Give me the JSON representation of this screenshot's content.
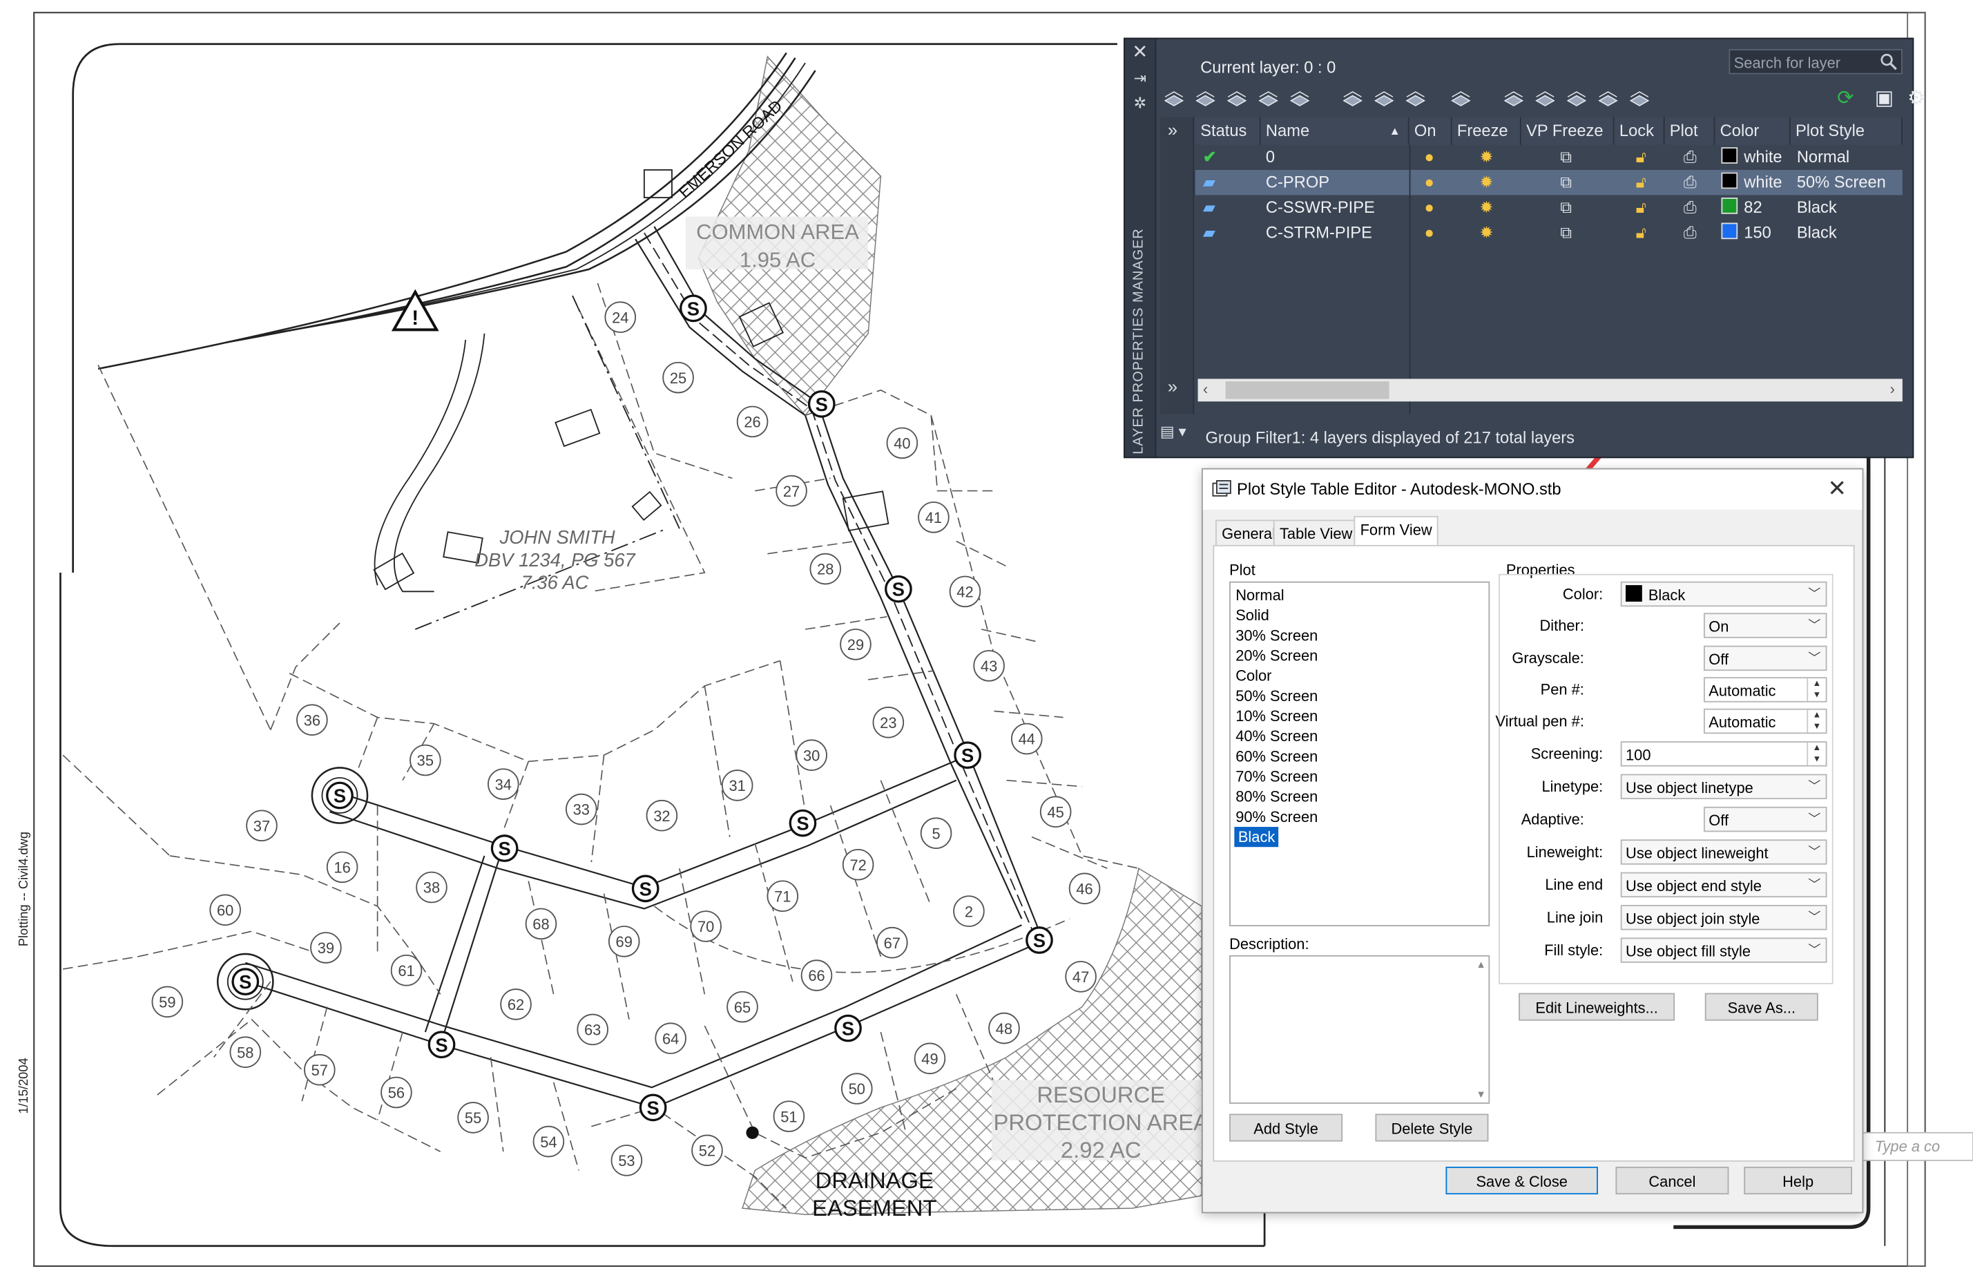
{
  "drawing": {
    "road_label": "EMERSON ROAD",
    "common_area": {
      "title": "COMMON AREA",
      "acres": "1.95 AC"
    },
    "owner": {
      "name": "JOHN SMITH",
      "deed": "DBV 1234, PG 567",
      "acres": "7.36 AC"
    },
    "resource_area": {
      "line1": "RESOURCE",
      "line2": "PROTECTION AREA",
      "acres": "2.92 AC"
    },
    "drainage": {
      "line1": "DRAINAGE",
      "line2": "EASEMENT"
    },
    "plot_info": {
      "plotting": "Plotting",
      "separator": "--",
      "file": "Civil4.dwg",
      "date": "1/15/2004"
    },
    "manhole_symbol": "S",
    "command_hint": "Type a co",
    "lots": [
      "24",
      "25",
      "26",
      "27",
      "28",
      "29",
      "23",
      "30",
      "31",
      "32",
      "33",
      "34",
      "35",
      "36",
      "37",
      "16",
      "38",
      "60",
      "39",
      "61",
      "59",
      "58",
      "57",
      "56",
      "55",
      "54",
      "53",
      "52",
      "51",
      "50",
      "49",
      "48",
      "47",
      "46",
      "45",
      "44",
      "43",
      "42",
      "41",
      "40",
      "5",
      "72",
      "71",
      "70",
      "69",
      "68",
      "62",
      "63",
      "64",
      "65",
      "66",
      "67",
      "2"
    ]
  },
  "layer_panel": {
    "title": "LAYER PROPERTIES MANAGER",
    "current_layer": "Current layer: 0 : 0",
    "search_placeholder": "Search for layer",
    "columns": [
      "Status",
      "Name",
      "On",
      "Freeze",
      "VP Freeze",
      "Lock",
      "Plot",
      "Color",
      "Plot Style"
    ],
    "rows": [
      {
        "name": "0",
        "color_name": "white",
        "color_hex": "#000000",
        "plot_style": "Normal",
        "status": "current",
        "selected": false
      },
      {
        "name": "C-PROP",
        "color_name": "white",
        "color_hex": "#000000",
        "plot_style": "50% Screen",
        "status": "layer",
        "selected": true
      },
      {
        "name": "C-SSWR-PIPE",
        "color_name": "82",
        "color_hex": "#1a9a2a",
        "plot_style": "Black",
        "status": "layer",
        "selected": false
      },
      {
        "name": "C-STRM-PIPE",
        "color_name": "150",
        "color_hex": "#1a6cf0",
        "plot_style": "Black",
        "status": "layer",
        "selected": false
      }
    ],
    "status_text": "Group Filter1: 4 layers displayed of 217 total layers"
  },
  "plot_style_editor": {
    "title": "Plot Style Table Editor - Autodesk-MONO.stb",
    "tabs": [
      "General",
      "Table View",
      "Form View"
    ],
    "active_tab": "Form View",
    "plot_label": "Plot",
    "plot_styles": [
      "Normal",
      "Solid",
      "30% Screen",
      "20% Screen",
      "Color",
      "50% Screen",
      "10% Screen",
      "40% Screen",
      "60% Screen",
      "70% Screen",
      "80% Screen",
      "90% Screen",
      "Black"
    ],
    "selected_style": "Black",
    "description_label": "Description:",
    "properties_label": "Properties",
    "properties": {
      "color_label": "Color:",
      "color_value": "Black",
      "dither_label": "Dither:",
      "dither_value": "On",
      "grayscale_label": "Grayscale:",
      "grayscale_value": "Off",
      "pen_label": "Pen #:",
      "pen_value": "Automatic",
      "virtual_pen_label": "Virtual pen #:",
      "virtual_pen_value": "Automatic",
      "screening_label": "Screening:",
      "screening_value": "100",
      "linetype_label": "Linetype:",
      "linetype_value": "Use object linetype",
      "adaptive_label": "Adaptive:",
      "adaptive_value": "Off",
      "lineweight_label": "Lineweight:",
      "lineweight_value": "Use object lineweight",
      "line_end_label": "Line end",
      "line_end_value": "Use object end style",
      "line_join_label": "Line join",
      "line_join_value": "Use object join style",
      "fill_style_label": "Fill style:",
      "fill_style_value": "Use object fill style"
    },
    "buttons": {
      "edit_lineweights": "Edit Lineweights...",
      "save_as": "Save As...",
      "add_style": "Add Style",
      "delete_style": "Delete Style",
      "save_close": "Save & Close",
      "cancel": "Cancel",
      "help": "Help"
    }
  },
  "colors": {
    "annotation_arrow": "#e5383b",
    "panel_bg": "#3b4453",
    "selection_blue": "#0a64c8"
  }
}
